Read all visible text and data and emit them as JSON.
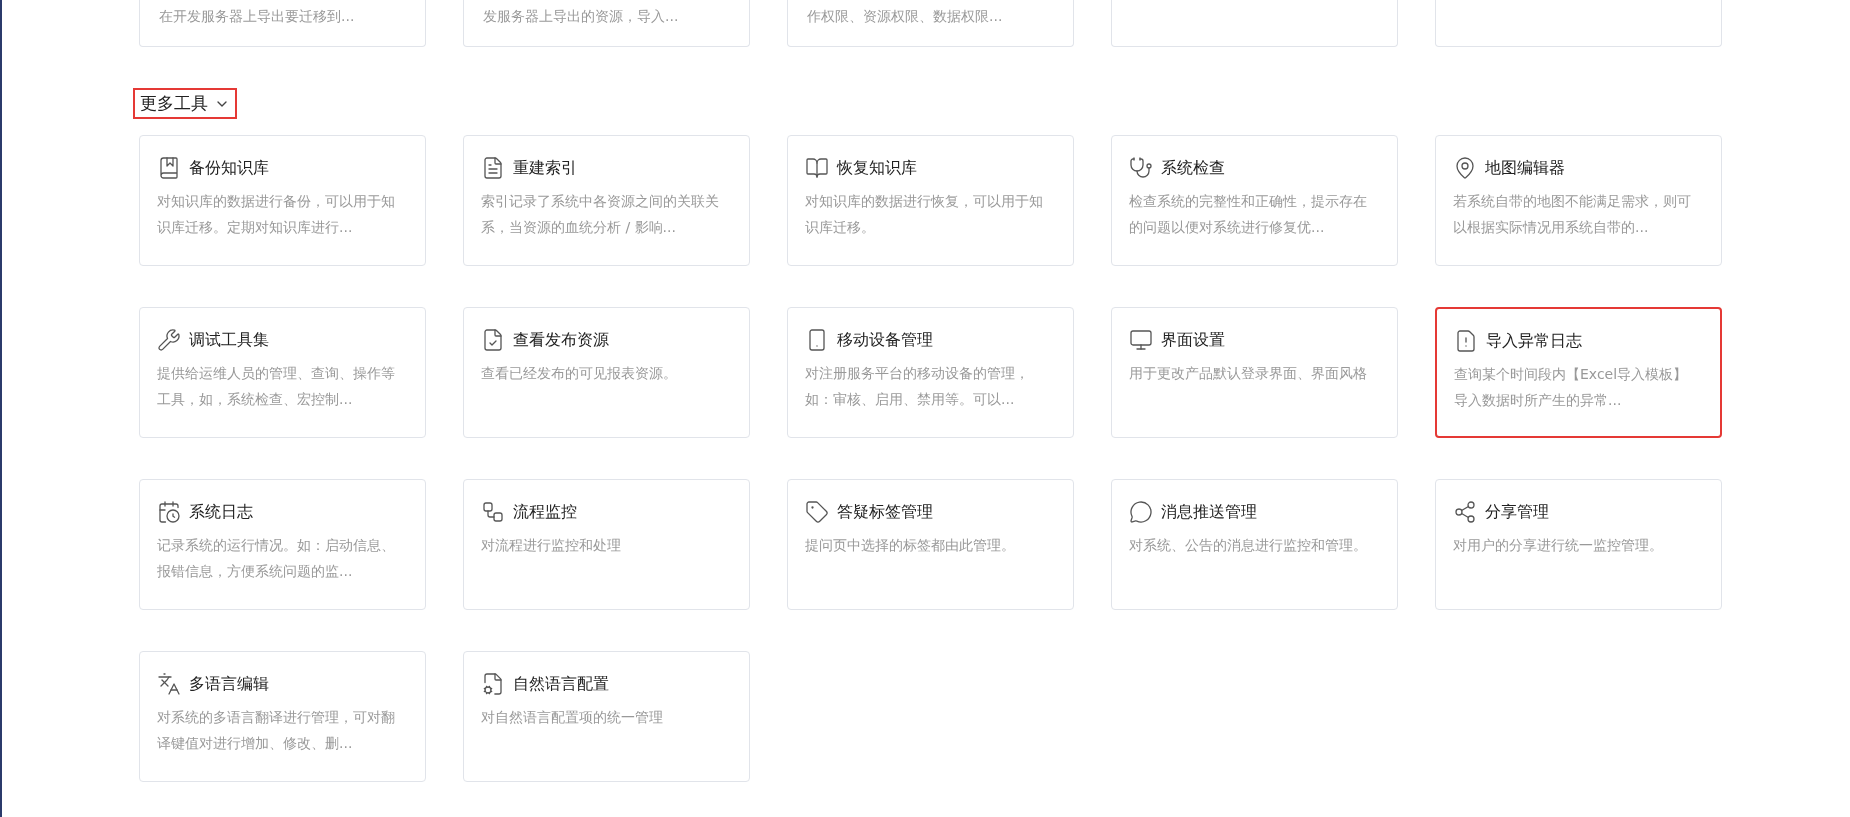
{
  "partial_cards": [
    {
      "kind": "text",
      "description": "在开发服务器上导出要迁移到..."
    },
    {
      "kind": "text",
      "description": "发服务器上导出的资源，导入..."
    },
    {
      "kind": "text",
      "description": "作权限、资源权限、数据权限..."
    },
    {
      "kind": "blank"
    },
    {
      "kind": "blank"
    }
  ],
  "section": {
    "title": "更多工具",
    "highlighted": true,
    "expanded": true
  },
  "tools": [
    {
      "title": "备份知识库",
      "description": "对知识库的数据进行备份，可以用于知识库迁移。定期对知识库进行...",
      "highlighted": false
    },
    {
      "title": "重建索引",
      "description": "索引记录了系统中各资源之间的关联关系，当资源的血统分析 / 影响...",
      "highlighted": false
    },
    {
      "title": "恢复知识库",
      "description": "对知识库的数据进行恢复，可以用于知识库迁移。",
      "highlighted": false
    },
    {
      "title": "系统检查",
      "description": "检查系统的完整性和正确性，提示存在的问题以便对系统进行修复优...",
      "highlighted": false
    },
    {
      "title": "地图编辑器",
      "description": "若系统自带的地图不能满足需求，则可以根据实际情况用系统自带的...",
      "highlighted": false
    },
    {
      "title": "调试工具集",
      "description": "提供给运维人员的管理、查询、操作等工具，如，系统检查、宏控制...",
      "highlighted": false
    },
    {
      "title": "查看发布资源",
      "description": "查看已经发布的可见报表资源。",
      "highlighted": false
    },
    {
      "title": "移动设备管理",
      "description": "对注册服务平台的移动设备的管理，如：审核、启用、禁用等。可以...",
      "highlighted": false
    },
    {
      "title": "界面设置",
      "description": "用于更改产品默认登录界面、界面风格",
      "highlighted": false
    },
    {
      "title": "导入异常日志",
      "description": "查询某个时间段内【Excel导入模板】导入数据时所产生的异常...",
      "highlighted": true
    },
    {
      "title": "系统日志",
      "description": "记录系统的运行情况。如：启动信息、报错信息，方便系统问题的监...",
      "highlighted": false
    },
    {
      "title": "流程监控",
      "description": "对流程进行监控和处理",
      "highlighted": false
    },
    {
      "title": "答疑标签管理",
      "description": "提问页中选择的标签都由此管理。",
      "highlighted": false
    },
    {
      "title": "消息推送管理",
      "description": "对系统、公告的消息进行监控和管理。",
      "highlighted": false
    },
    {
      "title": "分享管理",
      "description": "对用户的分享进行统一监控管理。",
      "highlighted": false
    },
    {
      "title": "多语言编辑",
      "description": "对系统的多语言翻译进行管理，可对翻译键值对进行增加、修改、删...",
      "highlighted": false
    },
    {
      "title": "自然语言配置",
      "description": "对自然语言配置项的统一管理",
      "highlighted": false
    }
  ]
}
